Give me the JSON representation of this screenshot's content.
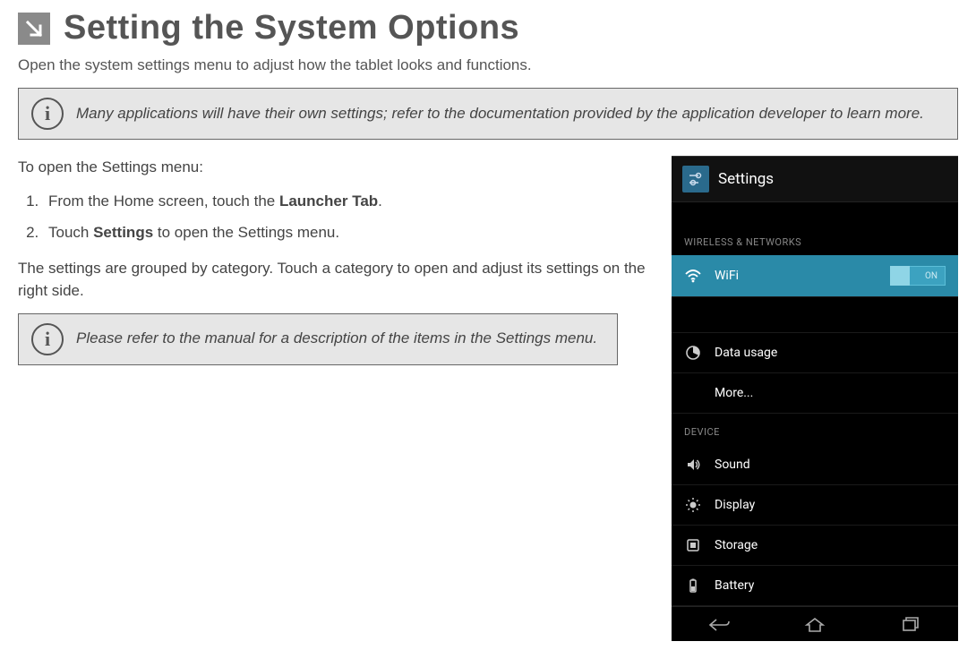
{
  "title": "Setting the System Options",
  "intro": "Open the system settings menu to adjust how the tablet looks and functions.",
  "note1": "Many applications will have their own settings; refer to the documentation provided by the application developer to learn more.",
  "instructions": {
    "lead": "To open the Settings menu:",
    "step1_pre": "From the Home screen, touch the ",
    "step1_bold": "Launcher Tab",
    "step1_post": ".",
    "step2_pre": "Touch ",
    "step2_bold": "Settings",
    "step2_post": " to open the Settings menu."
  },
  "grouped": "The settings are grouped by category. Touch a category to open and adjust its settings on the right side.",
  "note2": "Please refer to the manual for a description of the items in the Settings menu.",
  "tablet": {
    "header": "Settings",
    "section1": "WIRELESS & NETWORKS",
    "wifi": "WiFi",
    "toggle_on": "ON",
    "data_usage": "Data usage",
    "more": "More...",
    "section2": "DEVICE",
    "sound": "Sound",
    "display": "Display",
    "storage": "Storage",
    "battery": "Battery"
  }
}
